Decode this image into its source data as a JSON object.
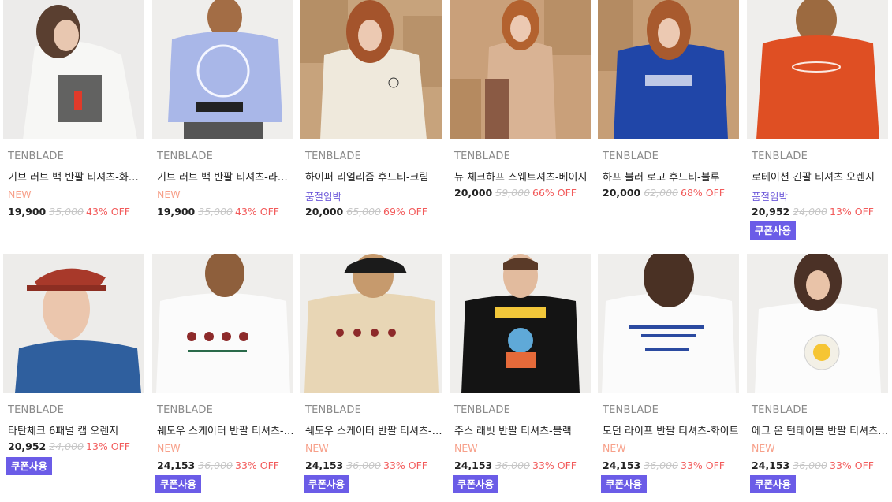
{
  "products": [
    {
      "brand": "TENBLADE",
      "name": "기브 러브 백 반팔 티셔츠-화이트",
      "tag": "NEW",
      "tag_type": "new",
      "price": "19,900",
      "original": "35,000",
      "discount": "43% OFF",
      "coupon": "",
      "image": "model-white-tee-back"
    },
    {
      "brand": "TENBLADE",
      "name": "기브 러브 백 반팔 티셔츠-라벤더",
      "tag": "NEW",
      "tag_type": "new",
      "price": "19,900",
      "original": "35,000",
      "discount": "43% OFF",
      "coupon": "",
      "image": "model-lavender-tee-back"
    },
    {
      "brand": "TENBLADE",
      "name": "하이퍼 리얼리즘 후드티-크림",
      "tag": "품절임박",
      "tag_type": "sold",
      "price": "20,000",
      "original": "65,000",
      "discount": "69% OFF",
      "coupon": "",
      "image": "model-cream-hoodie"
    },
    {
      "brand": "TENBLADE",
      "name": "뉴 체크하프 스웨트셔츠-베이지",
      "tag": "",
      "tag_type": "",
      "price": "20,000",
      "original": "59,000",
      "discount": "66% OFF",
      "coupon": "",
      "image": "model-beige-sweatshirt"
    },
    {
      "brand": "TENBLADE",
      "name": "하프 블러 로고 후드티-블루",
      "tag": "",
      "tag_type": "",
      "price": "20,000",
      "original": "62,000",
      "discount": "68% OFF",
      "coupon": "",
      "image": "model-blue-hoodie"
    },
    {
      "brand": "TENBLADE",
      "name": "로테이션 긴팔 티셔츠 오렌지",
      "tag": "품절임박",
      "tag_type": "sold",
      "price": "20,952",
      "original": "24,000",
      "discount": "13% OFF",
      "coupon": "쿠폰사용",
      "image": "model-orange-longsleeve"
    },
    {
      "brand": "TENBLADE",
      "name": "타탄체크 6패널 캡 오렌지",
      "tag": "",
      "tag_type": "",
      "price": "20,952",
      "original": "24,000",
      "discount": "13% OFF",
      "coupon": "쿠폰사용",
      "image": "model-tartan-cap"
    },
    {
      "brand": "TENBLADE",
      "name": "쉐도우 스케이터 반팔 티셔츠-화이트",
      "tag": "NEW",
      "tag_type": "new",
      "price": "24,153",
      "original": "36,000",
      "discount": "33% OFF",
      "coupon": "쿠폰사용",
      "image": "model-white-skater-tee"
    },
    {
      "brand": "TENBLADE",
      "name": "쉐도우 스케이터 반팔 티셔츠-베이지",
      "tag": "NEW",
      "tag_type": "new",
      "price": "24,153",
      "original": "36,000",
      "discount": "33% OFF",
      "coupon": "쿠폰사용",
      "image": "model-beige-skater-tee"
    },
    {
      "brand": "TENBLADE",
      "name": "주스 래빗 반팔 티셔츠-블랙",
      "tag": "NEW",
      "tag_type": "new",
      "price": "24,153",
      "original": "36,000",
      "discount": "33% OFF",
      "coupon": "쿠폰사용",
      "image": "model-black-rabbit-tee"
    },
    {
      "brand": "TENBLADE",
      "name": "모던 라이프 반팔 티셔츠-화이트",
      "tag": "NEW",
      "tag_type": "new",
      "price": "24,153",
      "original": "36,000",
      "discount": "33% OFF",
      "coupon": "쿠폰사용",
      "image": "model-white-modern-tee"
    },
    {
      "brand": "TENBLADE",
      "name": "에그 온 턴테이블 반팔 티셔츠-화이트",
      "tag": "NEW",
      "tag_type": "new",
      "price": "24,153",
      "original": "36,000",
      "discount": "33% OFF",
      "coupon": "쿠폰사용",
      "image": "model-white-egg-tee"
    }
  ],
  "colors": {
    "new_tag": "#f7a08a",
    "soldout_tag": "#6e5ad9",
    "discount": "#f25b5b",
    "coupon_bg": "#6b5ce7"
  }
}
